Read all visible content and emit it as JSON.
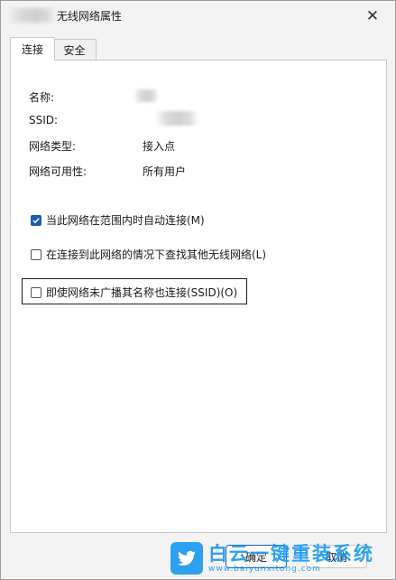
{
  "window": {
    "title": "无线网络属性",
    "close_glyph": "✕"
  },
  "tabs": [
    {
      "label": "连接",
      "active": true
    },
    {
      "label": "安全",
      "active": false
    }
  ],
  "properties": [
    {
      "label": "名称:",
      "value": ""
    },
    {
      "label": "SSID:",
      "value": ""
    },
    {
      "label": "网络类型:",
      "value": "接入点"
    },
    {
      "label": "网络可用性:",
      "value": "所有用户"
    }
  ],
  "options": [
    {
      "label": "当此网络在范围内时自动连接(M)",
      "checked": true
    },
    {
      "label": "在连接到此网络的情况下查找其他无线网络(L)",
      "checked": false
    },
    {
      "label": "即使网络未广播其名称也连接(SSID)(O)",
      "checked": false
    }
  ],
  "buttons": {
    "ok": "确定",
    "cancel": "取消"
  },
  "watermark": {
    "main": "白云一键重装系统",
    "url": "www.baiyunxitong.com"
  },
  "colors": {
    "accent": "#1b5fb4",
    "watermark": "#1d9bf0"
  }
}
